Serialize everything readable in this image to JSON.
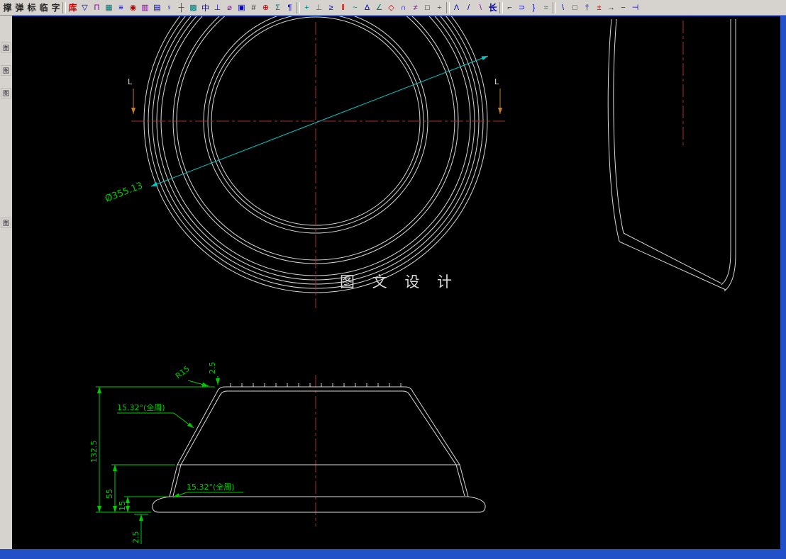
{
  "window": {
    "toolbar_items": [
      {
        "t": "text",
        "g": "撑"
      },
      {
        "t": "text",
        "g": "弹"
      },
      {
        "t": "text",
        "g": "标"
      },
      {
        "t": "text",
        "g": "临"
      },
      {
        "t": "text",
        "g": "字"
      },
      {
        "t": "sep"
      },
      {
        "t": "text",
        "g": "库",
        "c": "#cc0000"
      },
      {
        "t": "icon",
        "g": "▽",
        "c": "#0000bb"
      },
      {
        "t": "icon",
        "g": "Π",
        "c": "#8800aa"
      },
      {
        "t": "icon",
        "g": "▦",
        "c": "#007878"
      },
      {
        "t": "icon",
        "g": "≡",
        "c": "#0000bb"
      },
      {
        "t": "icon",
        "g": "◉",
        "c": "#bb0000"
      },
      {
        "t": "icon",
        "g": "▥",
        "c": "#8800aa"
      },
      {
        "t": "icon",
        "g": "▤",
        "c": "#0000bb"
      },
      {
        "t": "icon",
        "g": "♀",
        "c": "#0000bb"
      },
      {
        "t": "icon",
        "g": "┼",
        "c": "#333333"
      },
      {
        "t": "icon",
        "g": "▩",
        "c": "#007878"
      },
      {
        "t": "icon",
        "g": "中",
        "c": "#0000bb"
      },
      {
        "t": "icon",
        "g": "⊥",
        "c": "#0000bb"
      },
      {
        "t": "icon",
        "g": "⌀",
        "c": "#8800aa"
      },
      {
        "t": "icon",
        "g": "▣",
        "c": "#0000bb"
      },
      {
        "t": "icon",
        "g": "#",
        "c": "#333333"
      },
      {
        "t": "icon",
        "g": "⊕",
        "c": "#bb0000"
      },
      {
        "t": "icon",
        "g": "Σ",
        "c": "#007878"
      },
      {
        "t": "icon",
        "g": "¶",
        "c": "#0000bb"
      },
      {
        "t": "sep"
      },
      {
        "t": "icon",
        "g": "+",
        "c": "#007878"
      },
      {
        "t": "icon",
        "g": "⊥",
        "c": "#007878"
      },
      {
        "t": "icon",
        "g": "≥",
        "c": "#0000bb"
      },
      {
        "t": "icon",
        "g": "‖",
        "c": "#bb0000"
      },
      {
        "t": "icon",
        "g": "~",
        "c": "#007878"
      },
      {
        "t": "icon",
        "g": "Δ",
        "c": "#0000bb"
      },
      {
        "t": "icon",
        "g": "∠",
        "c": "#007878"
      },
      {
        "t": "icon",
        "g": "◇",
        "c": "#bb0000"
      },
      {
        "t": "icon",
        "g": "∩",
        "c": "#0000bb"
      },
      {
        "t": "icon",
        "g": "≠",
        "c": "#8800aa"
      },
      {
        "t": "icon",
        "g": "□",
        "c": "#0000bb"
      },
      {
        "t": "icon",
        "g": "÷",
        "c": "#333333"
      },
      {
        "t": "sep"
      },
      {
        "t": "icon",
        "g": "Λ",
        "c": "#0000bb"
      },
      {
        "t": "icon",
        "g": "/",
        "c": "#0000bb"
      },
      {
        "t": "icon",
        "g": "\\",
        "c": "#8800aa"
      },
      {
        "t": "text",
        "g": "长",
        "c": "#0000bb"
      },
      {
        "t": "sep"
      },
      {
        "t": "icon",
        "g": "⌐",
        "c": "#333333"
      },
      {
        "t": "icon",
        "g": "⊃",
        "c": "#0000bb"
      },
      {
        "t": "icon",
        "g": "}",
        "c": "#0000bb"
      },
      {
        "t": "icon",
        "g": "≈",
        "c": "#007878"
      },
      {
        "t": "sep"
      },
      {
        "t": "icon",
        "g": "\\",
        "c": "#0000bb"
      },
      {
        "t": "icon",
        "g": "□",
        "c": "#333333"
      },
      {
        "t": "icon",
        "g": "†",
        "c": "#0000bb"
      },
      {
        "t": "icon",
        "g": "±",
        "c": "#bb0000"
      },
      {
        "t": "icon",
        "g": "→",
        "c": "#333333"
      },
      {
        "t": "icon",
        "g": "−",
        "c": "#333333"
      },
      {
        "t": "icon",
        "g": "⊣",
        "c": "#0000bb"
      }
    ],
    "side_buttons": [
      "图",
      "图",
      "图",
      "图"
    ]
  },
  "drawing": {
    "watermark": "图 文 设 计",
    "dims": {
      "diameter": "Ø355.13",
      "radius_top": "R15",
      "thickness_top": "2.5",
      "angle_upper": "15.32°(全周)",
      "angle_lower": "15.32°(全周)",
      "height_total": "132.5",
      "height_base": "55",
      "height_flange": "15",
      "thickness_bottom": "2.5",
      "section_left": "L",
      "section_right": "L"
    },
    "colors": {
      "background": "#000000",
      "geometry_line": "#d9d9d9",
      "centerline": "#a63232",
      "dimension": "#00cc00",
      "diameter_line": "#00c8c8",
      "section_marker": "#c08030",
      "window_border": "#2150c8",
      "toolbar_bg": "#d6d3ce"
    }
  }
}
